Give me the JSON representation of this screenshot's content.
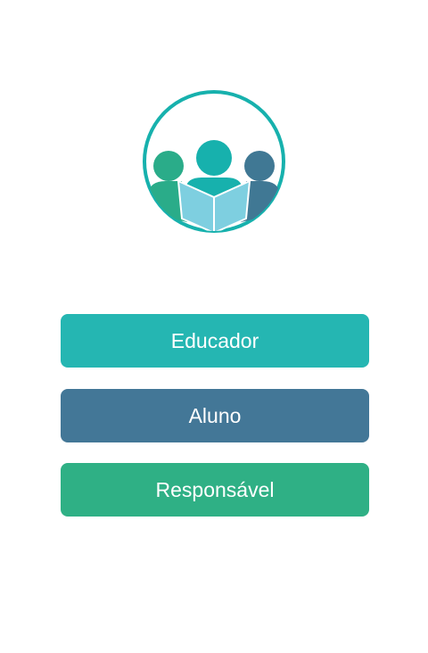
{
  "logo": {
    "icon": "people-reading-book-icon",
    "colors": {
      "ring": "#17b1ad",
      "left": "#2aac89",
      "center": "#17b1ad",
      "right": "#407894",
      "book": "#7ecfe0"
    }
  },
  "buttons": [
    {
      "id": "educador",
      "label": "Educador",
      "color": "#25b6b2"
    },
    {
      "id": "aluno",
      "label": "Aluno",
      "color": "#437797"
    },
    {
      "id": "responsavel",
      "label": "Responsável",
      "color": "#2fb085"
    }
  ]
}
